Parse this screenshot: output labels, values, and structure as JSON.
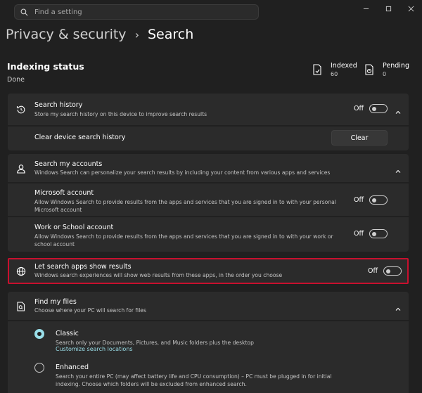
{
  "search": {
    "placeholder": "Find a setting"
  },
  "breadcrumb": {
    "parent": "Privacy & security",
    "separator": "›",
    "current": "Search"
  },
  "indexing": {
    "title": "Indexing status",
    "value": "Done",
    "indexed_label": "Indexed",
    "indexed_value": "60",
    "pending_label": "Pending",
    "pending_value": "0"
  },
  "search_history": {
    "title": "Search history",
    "desc": "Store my search history on this device to improve search results",
    "toggle_label": "Off",
    "clear_label": "Clear device search history",
    "clear_button": "Clear"
  },
  "accounts": {
    "title": "Search my accounts",
    "desc": "Windows Search can personalize your search results by including your content from various apps and services",
    "microsoft": {
      "title": "Microsoft account",
      "desc": "Allow Windows Search to provide results from the apps and services that you are signed in to with your personal Microsoft account",
      "toggle_label": "Off"
    },
    "work": {
      "title": "Work or School account",
      "desc": "Allow Windows Search to provide results from the apps and services that you are signed in to with your work or school account",
      "toggle_label": "Off"
    }
  },
  "search_apps": {
    "title": "Let search apps show results",
    "desc": "Windows search experiences will show web results from these apps, in the order you choose",
    "toggle_label": "Off"
  },
  "find_files": {
    "title": "Find my files",
    "desc": "Choose where your PC will search for files",
    "classic": {
      "label": "Classic",
      "desc": "Search only your Documents, Pictures, and Music folders plus the desktop",
      "link": "Customize search locations"
    },
    "enhanced": {
      "label": "Enhanced",
      "desc": "Search your entire PC (may affect battery life and CPU consumption) – PC must be plugged in for initial indexing. Choose which folders will be excluded from enhanced search."
    }
  },
  "colors": {
    "accent": "#9adfe9",
    "highlight": "#c8102e",
    "background": "#202020",
    "card": "#2b2b2b"
  }
}
